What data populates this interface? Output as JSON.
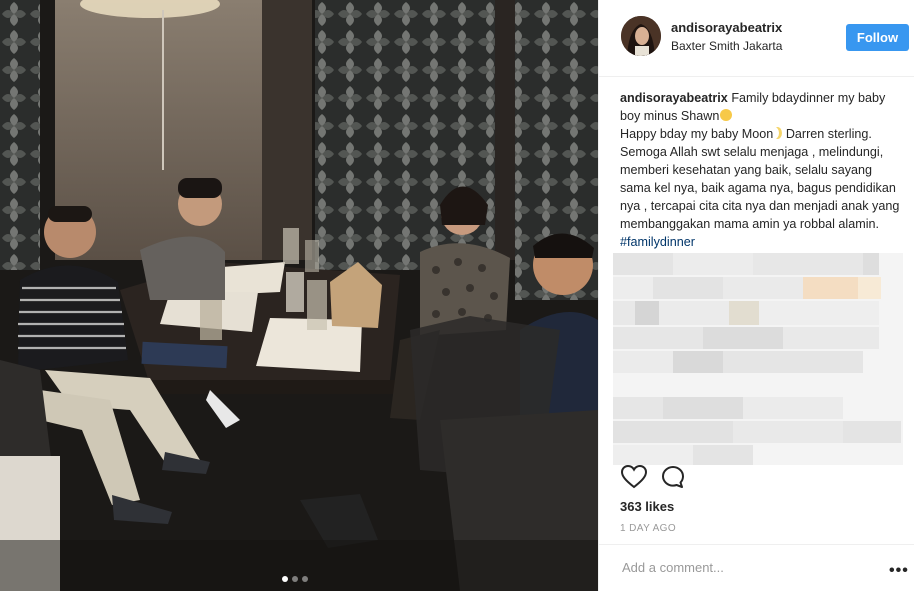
{
  "post": {
    "username": "andisorayabeatrix",
    "location": "Baxter Smith Jakarta",
    "follow_label": "Follow",
    "caption": {
      "username": "andisorayabeatrix",
      "line1": "Family bdaydinner my baby boy minus Shawn",
      "line2a": "Happy bday my baby Moon",
      "line2b": "Darren sterling. Semoga Allah swt selalu menjaga , melindungi, memberi kesehatan yang baik, selalu sayang sama kel nya, baik agama nya, bagus pendidikan nya , tercapai cita cita nya dan menjadi anak yang membanggakan mama amin ya robbal alamin.",
      "hashtag": "#familydinner",
      "emoji_face": "sad-face-emoji",
      "emoji_moon": "crescent-moon-emoji"
    },
    "likes": "363 likes",
    "time_ago": "1 DAY AGO",
    "comment_placeholder": "Add a comment...",
    "more_label": "•••",
    "carousel": {
      "count": 3,
      "active_index": 0
    }
  },
  "icons": {
    "like": "heart-icon",
    "comment": "comment-bubble-icon"
  },
  "colors": {
    "follow_button": "#3897f0",
    "hashtag": "#003569",
    "muted_text": "#999999"
  }
}
